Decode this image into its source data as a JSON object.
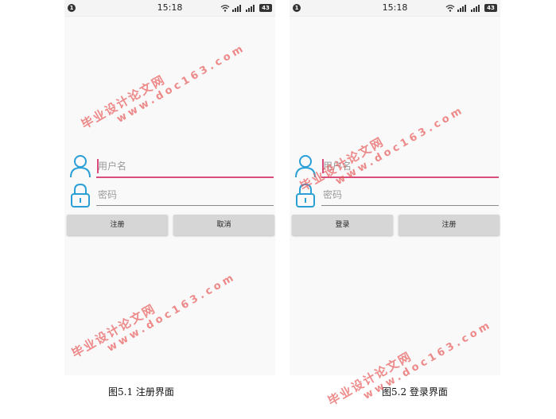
{
  "status_bar": {
    "notification_count": "1",
    "time": "15:18",
    "battery": "43",
    "icons": [
      "notification-icon",
      "wifi-icon",
      "signal-icon",
      "signal-icon",
      "battery-icon"
    ]
  },
  "register_screen": {
    "username_placeholder": "用户名",
    "password_placeholder": "密码",
    "primary_button": "注册",
    "secondary_button": "取消",
    "caption": "图5.1 注册界面"
  },
  "login_screen": {
    "username_placeholder": "用户名",
    "password_placeholder": "密码",
    "primary_button": "登录",
    "secondary_button": "注册",
    "caption": "图5.2 登录界面"
  },
  "watermark": {
    "text_cn": "毕业设计论文网",
    "text_url": "www.doc163.com"
  },
  "colors": {
    "accent": "#d94d7a",
    "icon_blue": "#2a9fd6",
    "button_gray": "#d6d6d6",
    "watermark": "#e85a5a"
  }
}
